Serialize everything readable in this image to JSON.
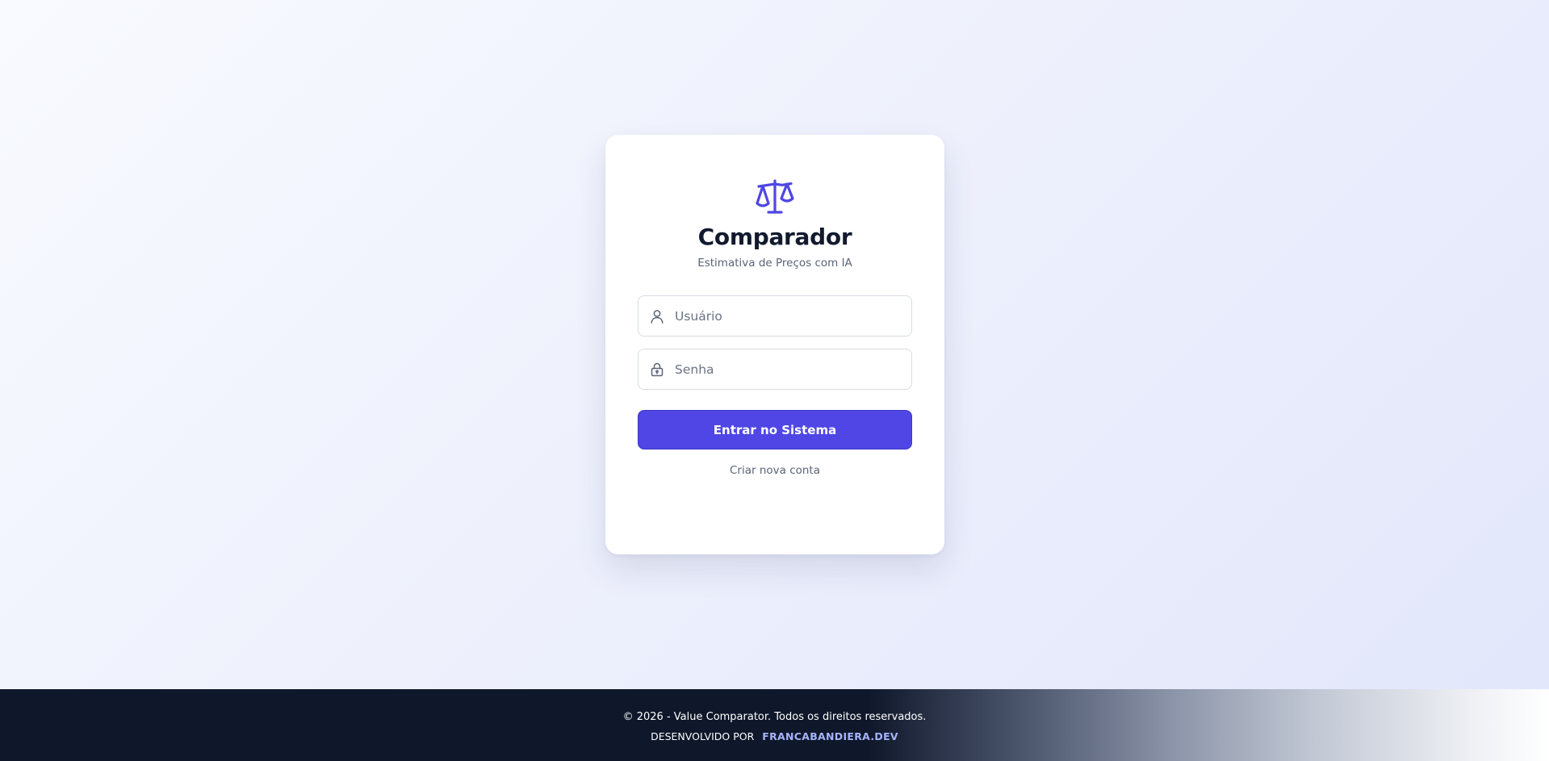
{
  "brand": {
    "icon": "scale-icon",
    "title": "Comparador",
    "subtitle": "Estimativa de Preços com IA"
  },
  "form": {
    "username": {
      "icon": "user-icon",
      "placeholder": "Usuário",
      "value": ""
    },
    "password": {
      "icon": "lock-icon",
      "placeholder": "Senha",
      "value": ""
    },
    "submit_label": "Entrar no Sistema",
    "signup_link": "Criar nova conta"
  },
  "footer": {
    "copyright": "© 2026 - Value Comparator. Todos os direitos reservados.",
    "developed_by": "DESENVOLVIDO POR",
    "developer": "FRANCABANDIERA.DEV"
  },
  "colors": {
    "accent": "#4f46e5",
    "title": "#111a2e",
    "footer_bg": "#0f172a",
    "developer_link": "#a5b4fc"
  }
}
